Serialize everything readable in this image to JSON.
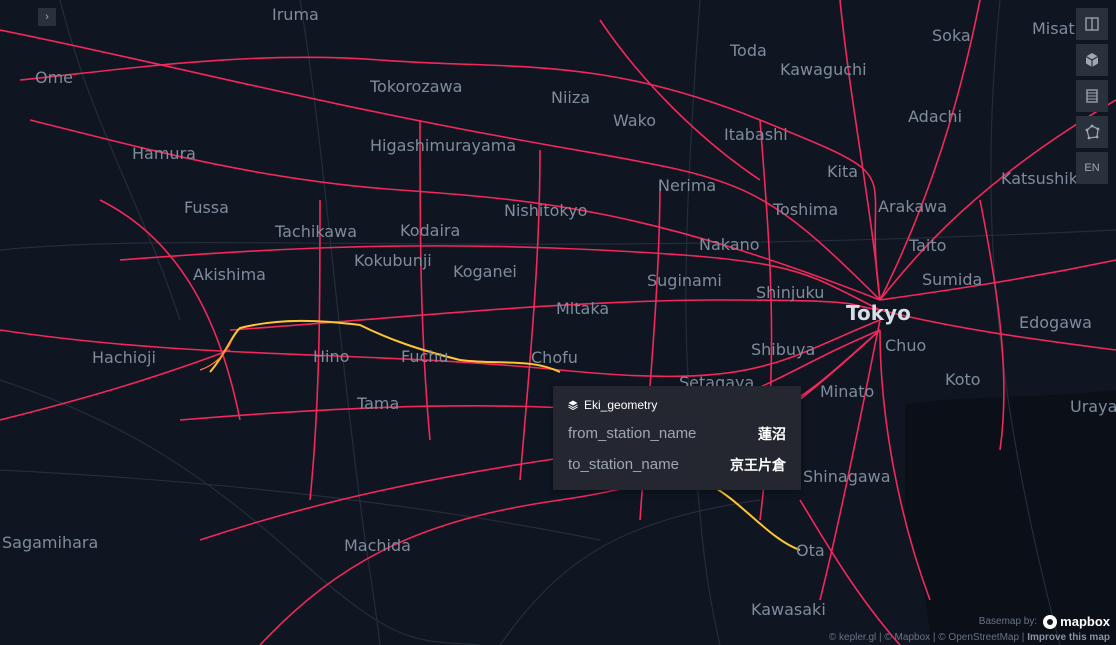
{
  "map": {
    "places": [
      {
        "name": "Iruma"
      },
      {
        "name": "Misat"
      },
      {
        "name": "Soka"
      },
      {
        "name": "Toda"
      },
      {
        "name": "Ome"
      },
      {
        "name": "Tokorozawa"
      },
      {
        "name": "Niiza"
      },
      {
        "name": "Kawaguchi"
      },
      {
        "name": "Adachi"
      },
      {
        "name": "Wako"
      },
      {
        "name": "Itabashi"
      },
      {
        "name": "Hamura"
      },
      {
        "name": "Higashimurayama"
      },
      {
        "name": "Kita"
      },
      {
        "name": "Katsushik"
      },
      {
        "name": "Nerima"
      },
      {
        "name": "Arakawa"
      },
      {
        "name": "Fussa"
      },
      {
        "name": "Nishitokyo"
      },
      {
        "name": "Toshima"
      },
      {
        "name": "Tachikawa"
      },
      {
        "name": "Kodaira"
      },
      {
        "name": "Nakano"
      },
      {
        "name": "Taito"
      },
      {
        "name": "Kokubunji"
      },
      {
        "name": "Koganei"
      },
      {
        "name": "Akishima"
      },
      {
        "name": "Suginami"
      },
      {
        "name": "Sumida"
      },
      {
        "name": "Shinjuku"
      },
      {
        "name": "Mitaka"
      },
      {
        "name": "Tokyo"
      },
      {
        "name": "Edogawa"
      },
      {
        "name": "Hachioji"
      },
      {
        "name": "Hino"
      },
      {
        "name": "Fuchu"
      },
      {
        "name": "Chofu"
      },
      {
        "name": "Chuo"
      },
      {
        "name": "Shibuya"
      },
      {
        "name": "Setagaya"
      },
      {
        "name": "Minato"
      },
      {
        "name": "Koto"
      },
      {
        "name": "Tama"
      },
      {
        "name": "Uraya"
      },
      {
        "name": "Shinagawa"
      },
      {
        "name": "Sagamihara"
      },
      {
        "name": "Machida"
      },
      {
        "name": "Ota"
      },
      {
        "name": "Kawasaki"
      }
    ],
    "colors": {
      "background": "#0f1521",
      "rail": "#ff2a5f",
      "highlight": "#ffc534"
    }
  },
  "toolbar": {
    "items": [
      {
        "icon": "split-map-icon"
      },
      {
        "icon": "3d-cube-icon"
      },
      {
        "icon": "legend-icon"
      },
      {
        "icon": "draw-polygon-icon"
      },
      {
        "label": "EN"
      }
    ]
  },
  "sidebar_toggle": {
    "icon": "chevron-right-icon",
    "glyph": "›"
  },
  "tooltip": {
    "layer": "Eki_geometry",
    "rows": [
      {
        "key": "from_station_name",
        "value": "蓮沼"
      },
      {
        "key": "to_station_name",
        "value": "京王片倉"
      }
    ]
  },
  "attribution": {
    "basemap_label": "Basemap by:",
    "logo_text": "mapbox",
    "credits": "© kepler.gl | © Mapbox | © OpenStreetMap |",
    "improve": "Improve this map"
  }
}
